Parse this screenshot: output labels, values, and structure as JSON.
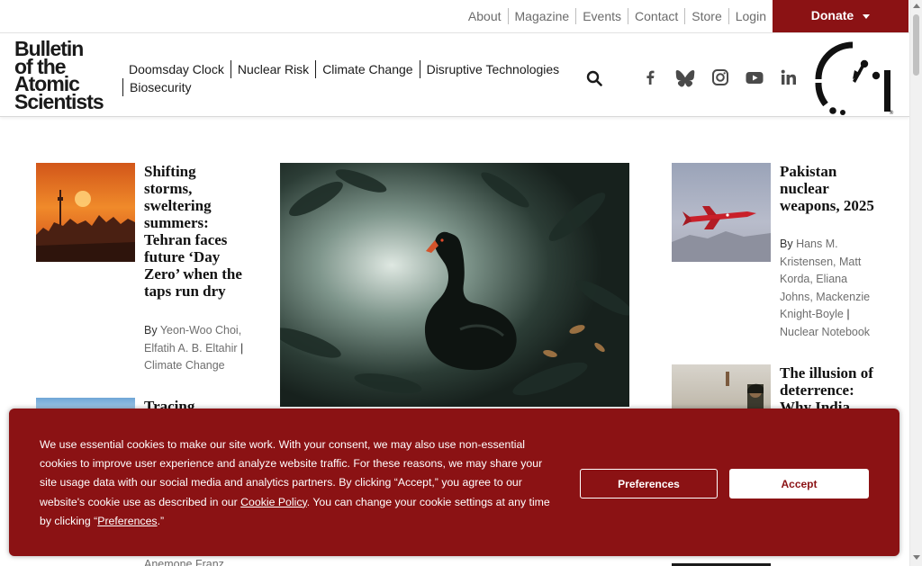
{
  "topbar": {
    "links": [
      "About",
      "Magazine",
      "Events",
      "Contact",
      "Store",
      "Login"
    ],
    "donate_label": "Donate"
  },
  "logo": {
    "lines": [
      "Bulletin",
      "of the",
      "Atomic",
      "Scientists"
    ]
  },
  "nav": {
    "items": [
      "Doomsday Clock",
      "Nuclear Risk",
      "Climate Change",
      "Disruptive Technologies",
      "Biosecurity"
    ]
  },
  "social_icons": [
    "facebook-icon",
    "bluesky-icon",
    "instagram-icon",
    "youtube-icon",
    "linkedin-icon"
  ],
  "articles_left": [
    {
      "title": "Shifting storms, sweltering summers: Tehran faces future ‘Day Zero’ when the taps run dry",
      "by": "By",
      "authors": "Yeon-Woo Choi, Elfatih A. B. Eltahir",
      "section": "Climate Change"
    },
    {
      "title": "Tracing",
      "author_partial": "Anemone Franz"
    }
  ],
  "articles_right": [
    {
      "title": "Pakistan nuclear weapons, 2025",
      "by": "By",
      "authors": "Hans M. Kristensen, Matt Korda, Eliana Johns, Mackenzie Knight-Boyle",
      "section": "Nuclear Notebook"
    },
    {
      "title": "The illusion of deterrence: Why India"
    }
  ],
  "cookie": {
    "text_1": "We use essential cookies to make our site work. With your consent, we may also use non-essential cookies to improve user experience and analyze website traffic. For these reasons, we may share your site usage data with our social media and analytics partners. By clicking “Accept,” you agree to our website's cookie use as described in our ",
    "policy_link": "Cookie Policy",
    "text_2": ". You can change your cookie settings at any time by clicking “",
    "pref_link": "Preferences",
    "text_3": ".”",
    "preferences_button": "Preferences",
    "accept_button": "Accept"
  },
  "colors": {
    "brand": "#8b1214",
    "text_muted": "#6e6e6e"
  }
}
